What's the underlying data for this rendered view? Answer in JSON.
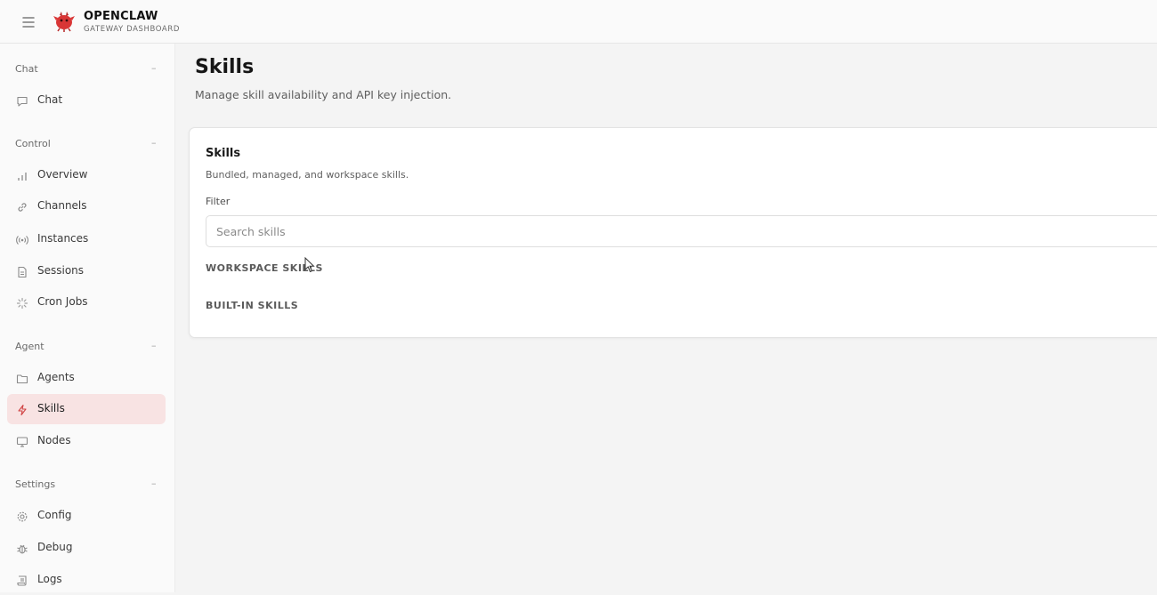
{
  "header": {
    "brand_title": "OPENCLAW",
    "brand_sub": "GATEWAY DASHBOARD",
    "menu_icon": "hamburger-icon",
    "logo_icon": "claw-logo-icon",
    "logo_color": "#d93636"
  },
  "sidebar": {
    "collapse_glyph": "–",
    "active_color": "#f8e3e3",
    "groups": [
      {
        "label": "Chat",
        "items": [
          {
            "label": "Chat",
            "icon": "chat-bubble-icon"
          }
        ]
      },
      {
        "label": "Control",
        "items": [
          {
            "label": "Overview",
            "icon": "bar-chart-icon"
          },
          {
            "label": "Channels",
            "icon": "link-icon"
          },
          {
            "label": "Instances",
            "icon": "radio-icon"
          },
          {
            "label": "Sessions",
            "icon": "document-icon"
          },
          {
            "label": "Cron Jobs",
            "icon": "loader-icon"
          }
        ]
      },
      {
        "label": "Agent",
        "items": [
          {
            "label": "Agents",
            "icon": "folder-icon"
          },
          {
            "label": "Skills",
            "icon": "lightning-icon",
            "active": true
          },
          {
            "label": "Nodes",
            "icon": "monitor-icon"
          }
        ]
      },
      {
        "label": "Settings",
        "items": [
          {
            "label": "Config",
            "icon": "gear-icon"
          },
          {
            "label": "Debug",
            "icon": "bug-icon"
          },
          {
            "label": "Logs",
            "icon": "scroll-icon"
          }
        ]
      }
    ]
  },
  "main": {
    "title": "Skills",
    "subtitle": "Manage skill availability and API key injection.",
    "card": {
      "title": "Skills",
      "subtitle": "Bundled, managed, and workspace skills.",
      "filter_label": "Filter",
      "search_placeholder": "Search skills",
      "search_value": "",
      "sections": [
        "WORKSPACE SKILLS",
        "BUILT-IN SKILLS"
      ]
    }
  }
}
